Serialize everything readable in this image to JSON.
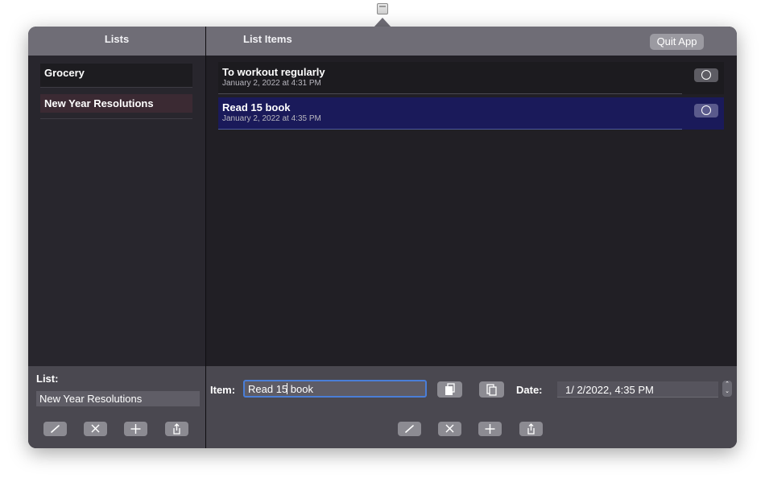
{
  "header": {
    "lists_title": "Lists",
    "items_title": "List Items",
    "quit_label": "Quit App"
  },
  "lists": [
    {
      "label": "Grocery"
    },
    {
      "label": "New Year Resolutions",
      "selected": true
    }
  ],
  "items": [
    {
      "title": "To workout regularly",
      "date": "January 2, 2022 at 4:31 PM"
    },
    {
      "title": "Read 15 book",
      "date": "January 2, 2022 at 4:35 PM",
      "selected": true
    }
  ],
  "list_editor": {
    "label": "List:",
    "value": "New Year Resolutions",
    "buttons": [
      "edit-icon",
      "delete-icon",
      "add-icon",
      "share-icon"
    ]
  },
  "item_editor": {
    "label": "Item:",
    "value_before_caret": "Read 15",
    "value_after_caret": " book",
    "date_label": "Date:",
    "date_value": "1/  2/2022,   4:35 PM",
    "stepper_up": "⌃",
    "stepper_down": "⌄",
    "tools": [
      "copy-icon",
      "paste-icon"
    ],
    "buttons": [
      "edit-icon",
      "delete-icon",
      "add-icon",
      "share-icon"
    ]
  },
  "colors": {
    "header_bg": "#6f6d76",
    "selected_item_bg": "#1a1a5a",
    "selected_list_bg": "#3b2a33",
    "focus_ring": "#4a7ed8"
  }
}
